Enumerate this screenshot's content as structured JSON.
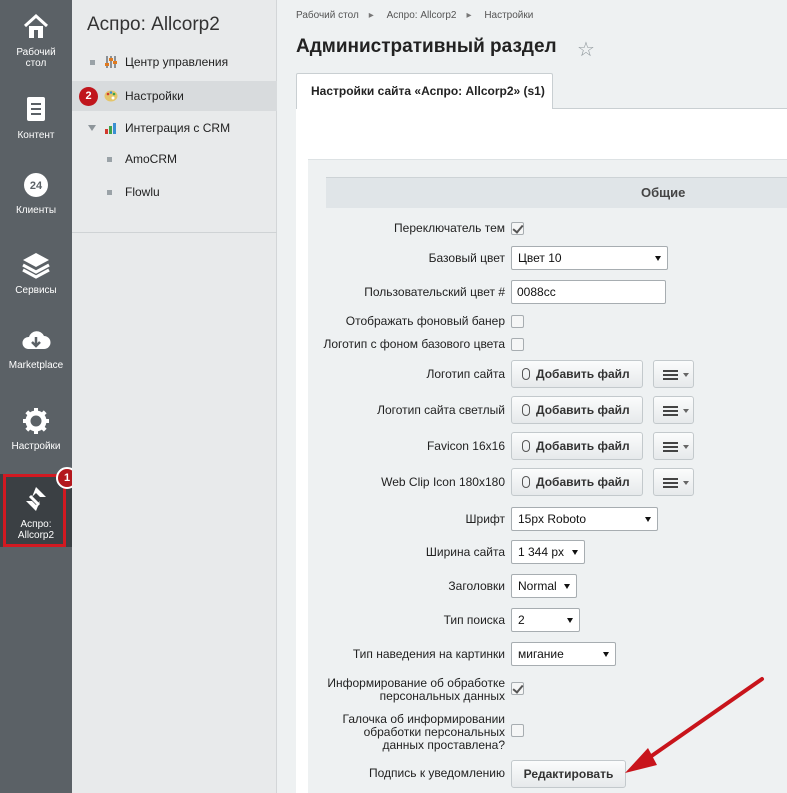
{
  "rail": {
    "items": [
      {
        "label_1": "Рабочий",
        "label_2": "стол",
        "icon": "home-icon"
      },
      {
        "label_1": "Контент",
        "label_2": "",
        "icon": "document-icon"
      },
      {
        "label_1": "Клиенты",
        "label_2": "",
        "icon": "clients-24-icon"
      },
      {
        "label_1": "Сервисы",
        "label_2": "",
        "icon": "layers-icon"
      },
      {
        "label_1": "Marketplace",
        "label_2": "",
        "icon": "cloud-download-icon"
      },
      {
        "label_1": "Настройки",
        "label_2": "",
        "icon": "gear-icon"
      },
      {
        "label_1": "Аспро:",
        "label_2": "Allcorp2",
        "icon": "aspro-logo-icon"
      }
    ],
    "badge": "1",
    "icon_24": "24"
  },
  "menu": {
    "title": "Аспро: Allcorp2",
    "items": [
      {
        "label": "Центр управления",
        "icon": "sliders-icon"
      },
      {
        "label": "Настройки",
        "icon": "palette-icon"
      },
      {
        "label": "Интеграция с CRM",
        "icon": "chart-icon"
      },
      {
        "label": "AmoCRM"
      },
      {
        "label": "Flowlu"
      }
    ],
    "badge": "2"
  },
  "breadcrumbs": [
    "Рабочий стол",
    "Аспро: Allcorp2",
    "Настройки"
  ],
  "page_title": "Административный раздел",
  "tab": "Настройки сайта «Аспро: Allcorp2» (s1)",
  "section_heading": "Общие",
  "form": {
    "theme_switch": "Переключатель тем",
    "base_color_label": "Базовый цвет",
    "base_color_value": "Цвет 10",
    "custom_color_label": "Пользовательский цвет #",
    "custom_color_value": "0088cc",
    "bg_banner": "Отображать фоновый банер",
    "logo_bg": "Логотип с фоном базового цвета",
    "logo_label": "Логотип сайта",
    "logo_light_label": "Логотип сайта светлый",
    "favicon_label": "Favicon 16x16",
    "webclip_label": "Web Clip Icon 180x180",
    "add_file": "Добавить файл",
    "font_label": "Шрифт",
    "font_value": "15px Roboto",
    "width_label": "Ширина сайта",
    "width_value": "1 344 px",
    "headings_label": "Заголовки",
    "headings_value": "Normal",
    "search_label": "Тип поиска",
    "search_value": "2",
    "hover_label": "Тип наведения на картинки",
    "hover_value": "мигание",
    "pd_info_1": "Информирование об обработке",
    "pd_info_2": "персональных данных",
    "pd_check_1": "Галочка об информировании",
    "pd_check_2": "обработки персональных",
    "pd_check_3": "данных проставлена?",
    "notice_label": "Подпись к уведомлению",
    "edit_button": "Редактировать"
  },
  "colors": {
    "accent_red": "#d21921",
    "rail_bg": "#5b6166"
  }
}
